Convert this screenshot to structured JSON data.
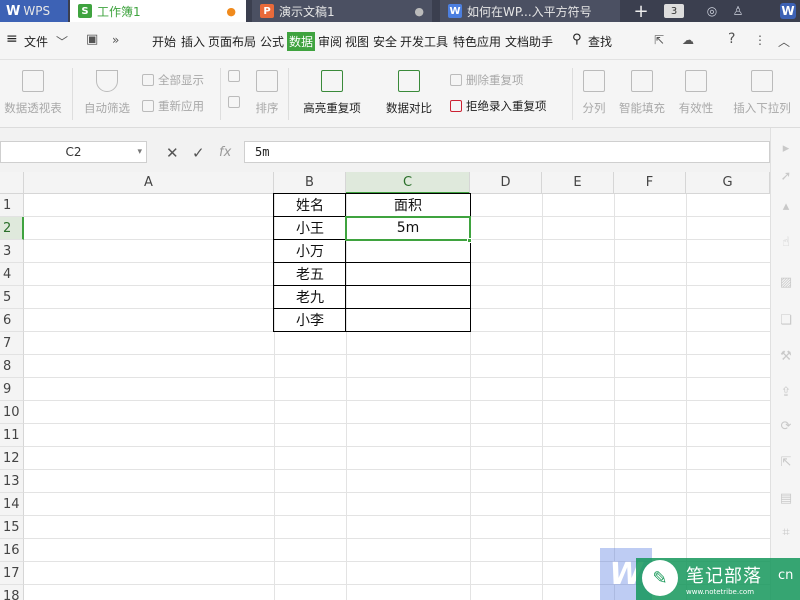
{
  "titlebar": {
    "tabs": [
      {
        "label": "WPS",
        "icon": "wps-logo-icon"
      },
      {
        "label": "工作簿1",
        "icon": "spreadsheet-icon",
        "icon_letter": "S"
      },
      {
        "label": "演示文稿1",
        "icon": "presentation-icon",
        "icon_letter": "P"
      },
      {
        "label": "如何在WP...入平方符号",
        "icon": "document-icon",
        "icon_letter": "W"
      }
    ],
    "tab_count": "3"
  },
  "menubar": {
    "file": "文件",
    "items": [
      "开始",
      "插入",
      "页面布局",
      "公式",
      "数据",
      "审阅",
      "视图",
      "安全",
      "开发工具",
      "特色应用",
      "文档助手"
    ],
    "active": "数据",
    "search": "查找"
  },
  "ribbon": {
    "pivot": "数据透视表",
    "autofilter": "自动筛选",
    "show_all": "全部显示",
    "reapply": "重新应用",
    "sort": "排序",
    "highlight_dup": "高亮重复项",
    "compare": "数据对比",
    "remove_dup": "删除重复项",
    "reject_dup": "拒绝录入重复项",
    "split": "分列",
    "smart_fill": "智能填充",
    "validity": "有效性",
    "insert_dropdown": "插入下拉列"
  },
  "formula_bar": {
    "cell_ref": "C2",
    "fx": "fx",
    "value": "5m"
  },
  "grid": {
    "columns": [
      "A",
      "B",
      "C",
      "D",
      "E",
      "F",
      "G"
    ],
    "selected_column": "C",
    "rows": [
      "1",
      "2",
      "3",
      "4",
      "5",
      "6",
      "7",
      "8",
      "9",
      "10",
      "11",
      "12",
      "13",
      "14",
      "15",
      "16",
      "17",
      "18"
    ],
    "selected_row": "2",
    "cells": {
      "B1": "姓名",
      "C1": "面积",
      "B2": "小王",
      "C2": "5m",
      "B3": "小万",
      "B4": "老五",
      "B5": "老九",
      "B6": "小李"
    }
  },
  "watermark": {
    "title": "笔记部落",
    "url": "www.notetribe.com",
    "suffix": "cn"
  },
  "colors": {
    "accent": "#3fa33f",
    "titlebar": "#3b3f4f",
    "wps_blue": "#3d62b5"
  }
}
